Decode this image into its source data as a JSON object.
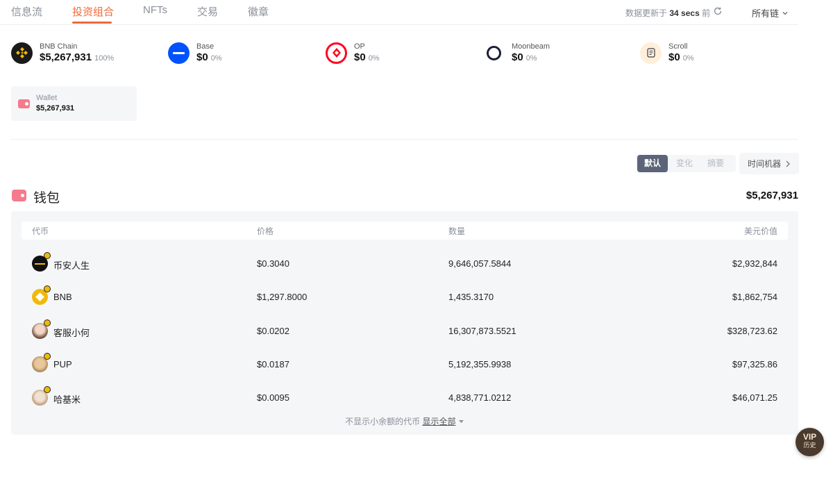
{
  "nav": {
    "tabs": [
      "信息流",
      "投资组合",
      "NFTs",
      "交易",
      "徽章"
    ],
    "active_tab": "投资组合",
    "updated_prefix": "数据更新于",
    "updated_value": "34 secs",
    "updated_suffix": "前",
    "chain_filter": "所有链"
  },
  "chains": [
    {
      "name": "BNB Chain",
      "value": "$5,267,931",
      "percent": "100%",
      "icon": "bnb-chain-icon"
    },
    {
      "name": "Base",
      "value": "$0",
      "percent": "0%",
      "icon": "base-icon"
    },
    {
      "name": "OP",
      "value": "$0",
      "percent": "0%",
      "icon": "op-icon"
    },
    {
      "name": "Moonbeam",
      "value": "$0",
      "percent": "0%",
      "icon": "moonbeam-icon"
    },
    {
      "name": "Scroll",
      "value": "$0",
      "percent": "0%",
      "icon": "scroll-icon"
    }
  ],
  "wallet_card": {
    "label": "Wallet",
    "amount": "$5,267,931"
  },
  "view_switch": {
    "options": [
      "默认",
      "变化",
      "摘要"
    ],
    "selected": "默认"
  },
  "time_machine": "时间机器",
  "wallet_section": {
    "title": "钱包",
    "total": "$5,267,931",
    "columns": [
      "代币",
      "价格",
      "数量",
      "美元价值"
    ],
    "rows": [
      {
        "token": "币安人生",
        "price": "$0.3040",
        "amount": "9,646,057.5844",
        "usd": "$2,932,844"
      },
      {
        "token": "BNB",
        "price": "$1,297.8000",
        "amount": "1,435.3170",
        "usd": "$1,862,754"
      },
      {
        "token": "客服小何",
        "price": "$0.0202",
        "amount": "16,307,873.5521",
        "usd": "$328,723.62"
      },
      {
        "token": "PUP",
        "price": "$0.0187",
        "amount": "5,192,355.9938",
        "usd": "$97,325.86"
      },
      {
        "token": "哈基米",
        "price": "$0.0095",
        "amount": "4,838,771.0212",
        "usd": "$46,071.25"
      }
    ],
    "hidden_note": "不显示小余额的代币",
    "show_all": "显示全部"
  },
  "vip": {
    "label": "VIP",
    "sub": "历史"
  },
  "colors": {
    "accent": "#ee6a3a",
    "wallet_pink": "#f47a8c",
    "bnb_yellow": "#f0b90b",
    "base_blue": "#0052ff",
    "op_red": "#ff0420"
  }
}
